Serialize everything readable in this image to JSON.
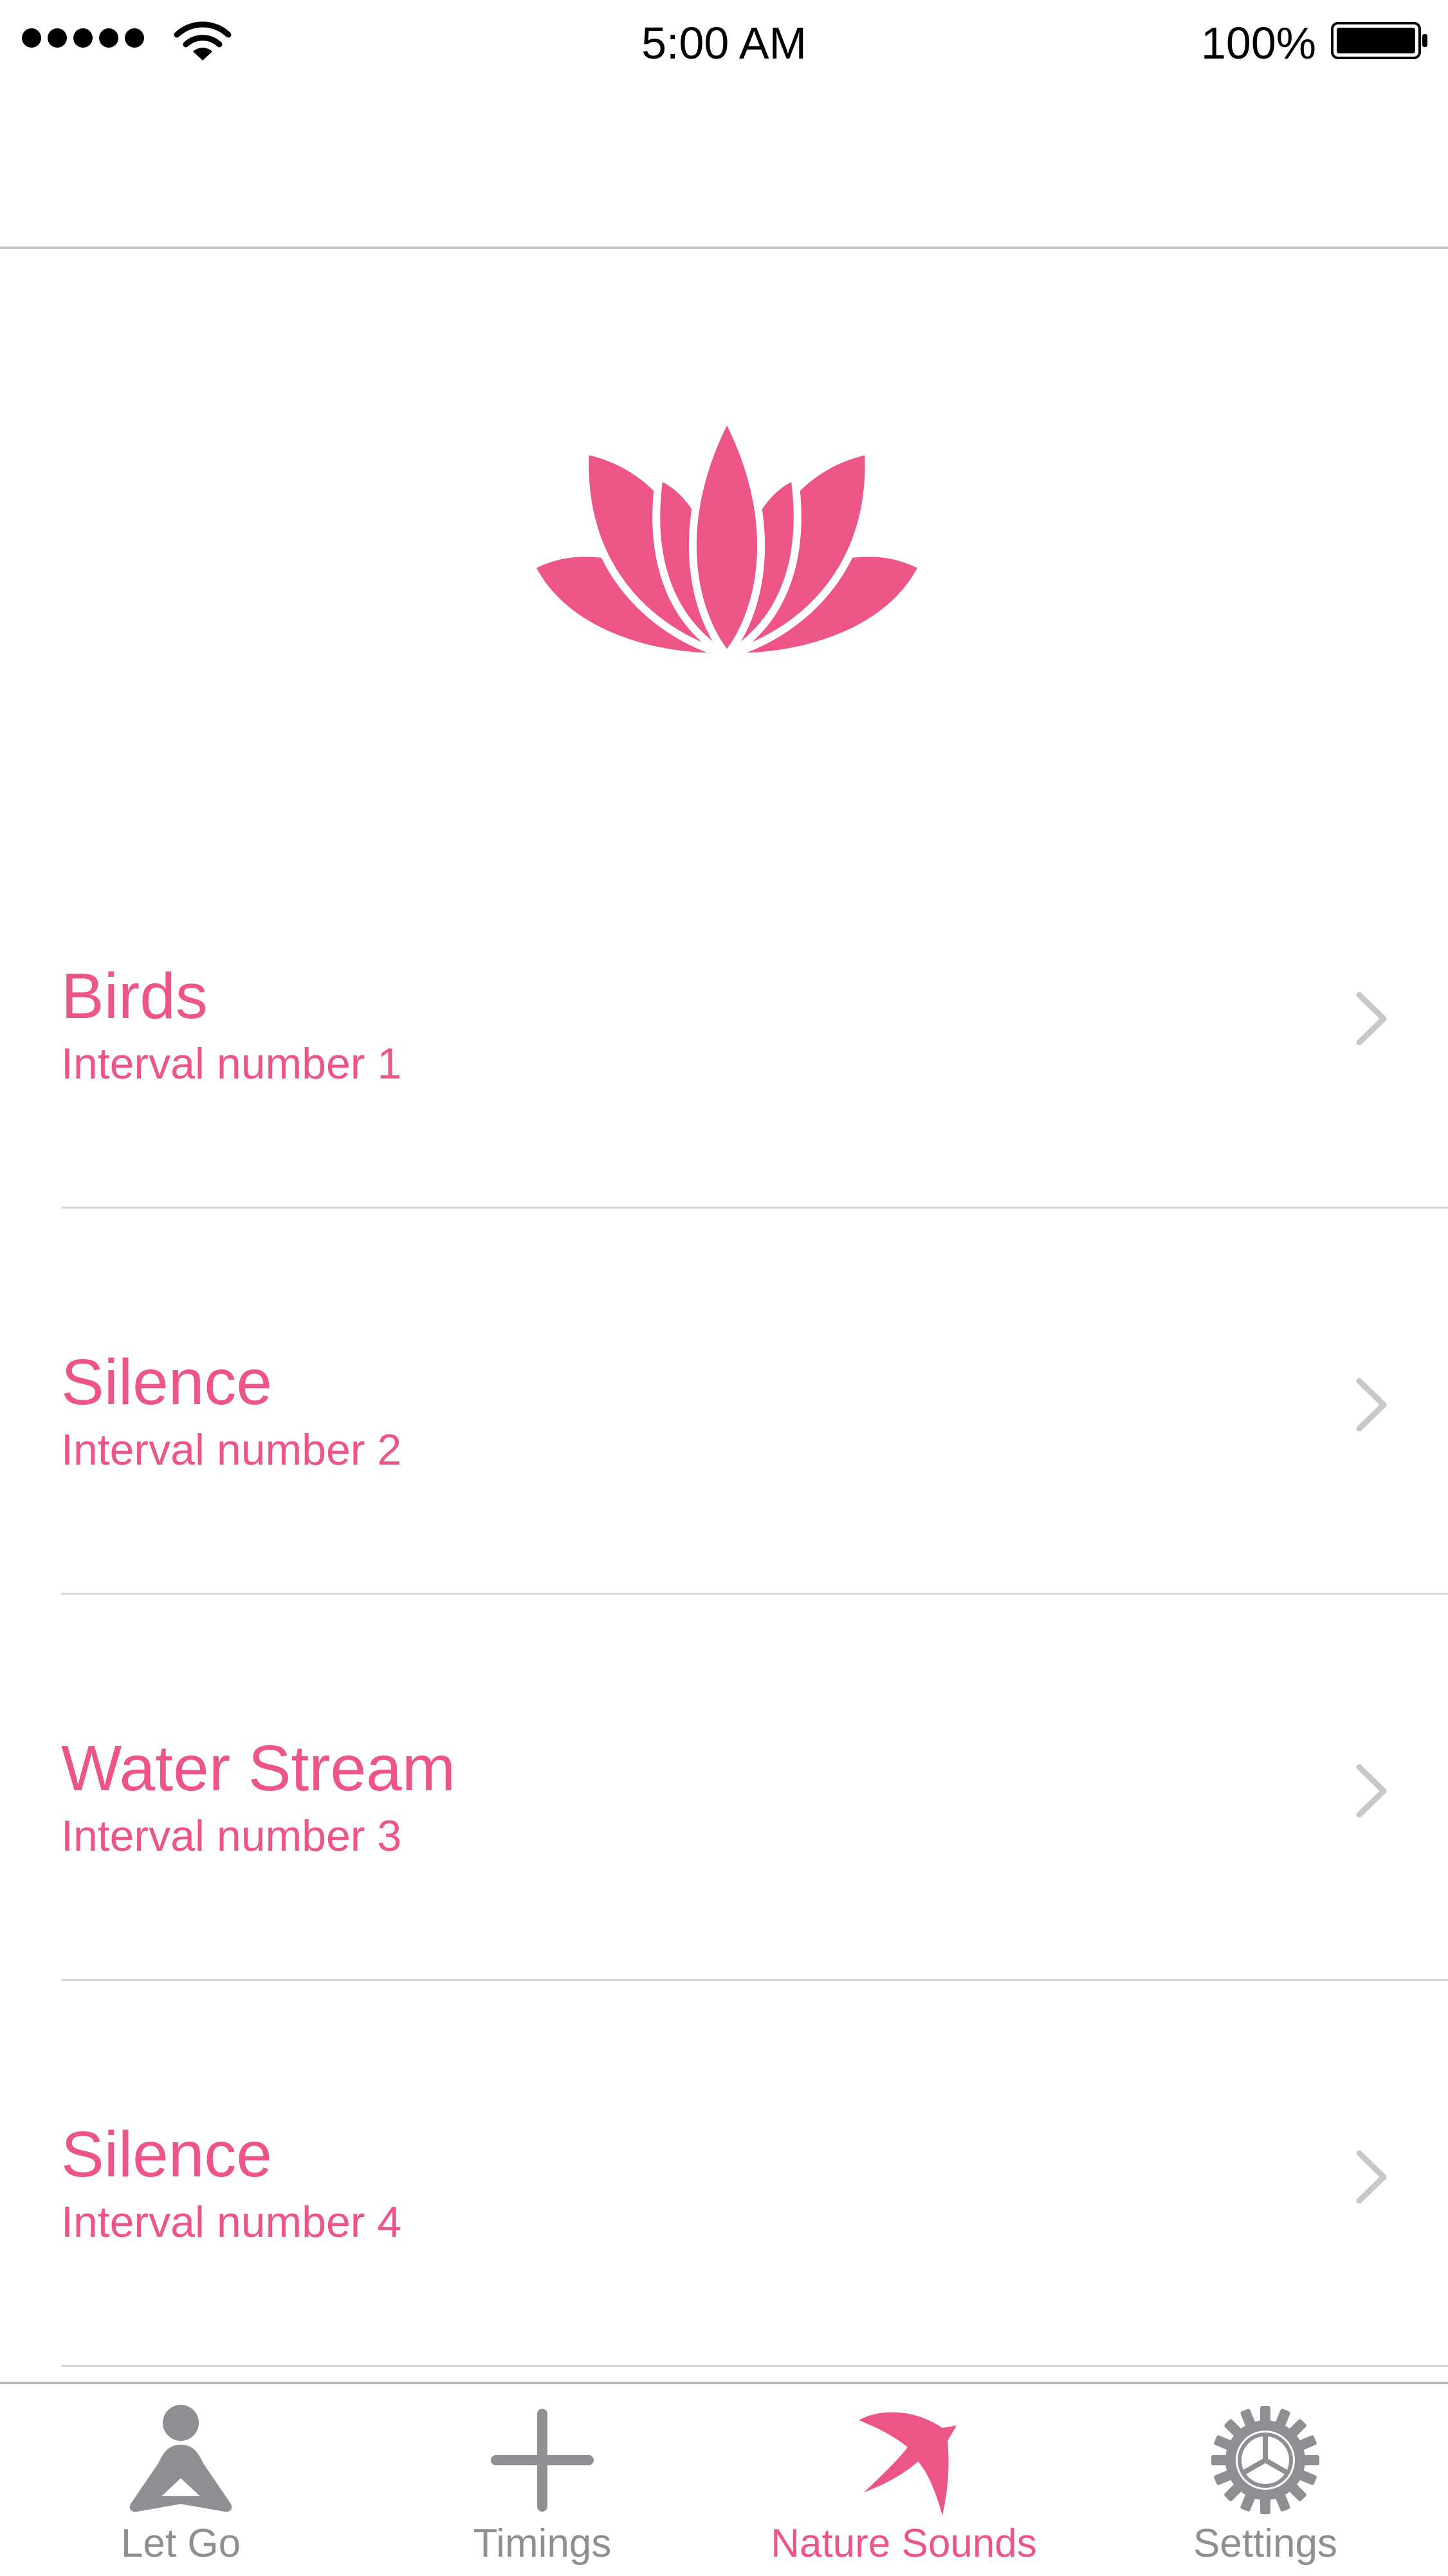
{
  "status_bar": {
    "time": "5:00 AM",
    "battery_percent": "100%",
    "signal_bars": 5,
    "icons": [
      "signal-dots-icon",
      "wifi-icon",
      "battery-icon"
    ]
  },
  "colors": {
    "accent": "#ec5586",
    "inactive": "#8e8e93",
    "chevron": "#c7c7cc",
    "divider": "#d6d6da"
  },
  "hero": {
    "icon": "lotus-icon"
  },
  "intervals": [
    {
      "title": "Birds",
      "subtitle": "Interval number 1"
    },
    {
      "title": "Silence",
      "subtitle": "Interval number 2"
    },
    {
      "title": "Water Stream",
      "subtitle": "Interval number 3"
    },
    {
      "title": "Silence",
      "subtitle": "Interval number 4"
    }
  ],
  "tabs": [
    {
      "label": "Let Go",
      "icon": "meditation-icon",
      "active": false
    },
    {
      "label": "Timings",
      "icon": "plus-icon",
      "active": false
    },
    {
      "label": "Nature Sounds",
      "icon": "bird-icon",
      "active": true
    },
    {
      "label": "Settings",
      "icon": "gear-icon",
      "active": false
    }
  ]
}
